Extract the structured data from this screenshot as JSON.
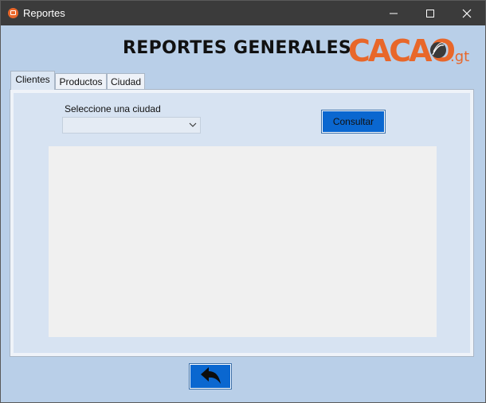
{
  "window": {
    "title": "Reportes",
    "controls": [
      "minimize",
      "maximize",
      "close"
    ]
  },
  "header": {
    "title": "REPORTES GENERALES",
    "logo": {
      "text": "CACAO",
      "suffix": ".gt",
      "color": "#e8672a"
    }
  },
  "tabs": [
    {
      "label": "Clientes",
      "active": true
    },
    {
      "label": "Productos",
      "active": false
    },
    {
      "label": "Ciudad",
      "active": false
    }
  ],
  "clientes": {
    "city_label": "Seleccione una ciudad",
    "city_value": "",
    "consult_label": "Consultar",
    "results_rows": []
  },
  "colors": {
    "background": "#b9cfe8",
    "titlebar": "#3b3b3b",
    "button": "#0a67d0",
    "accent": "#e8672a"
  },
  "icons": {
    "app": "app-icon",
    "back": "undo-arrow-icon"
  }
}
